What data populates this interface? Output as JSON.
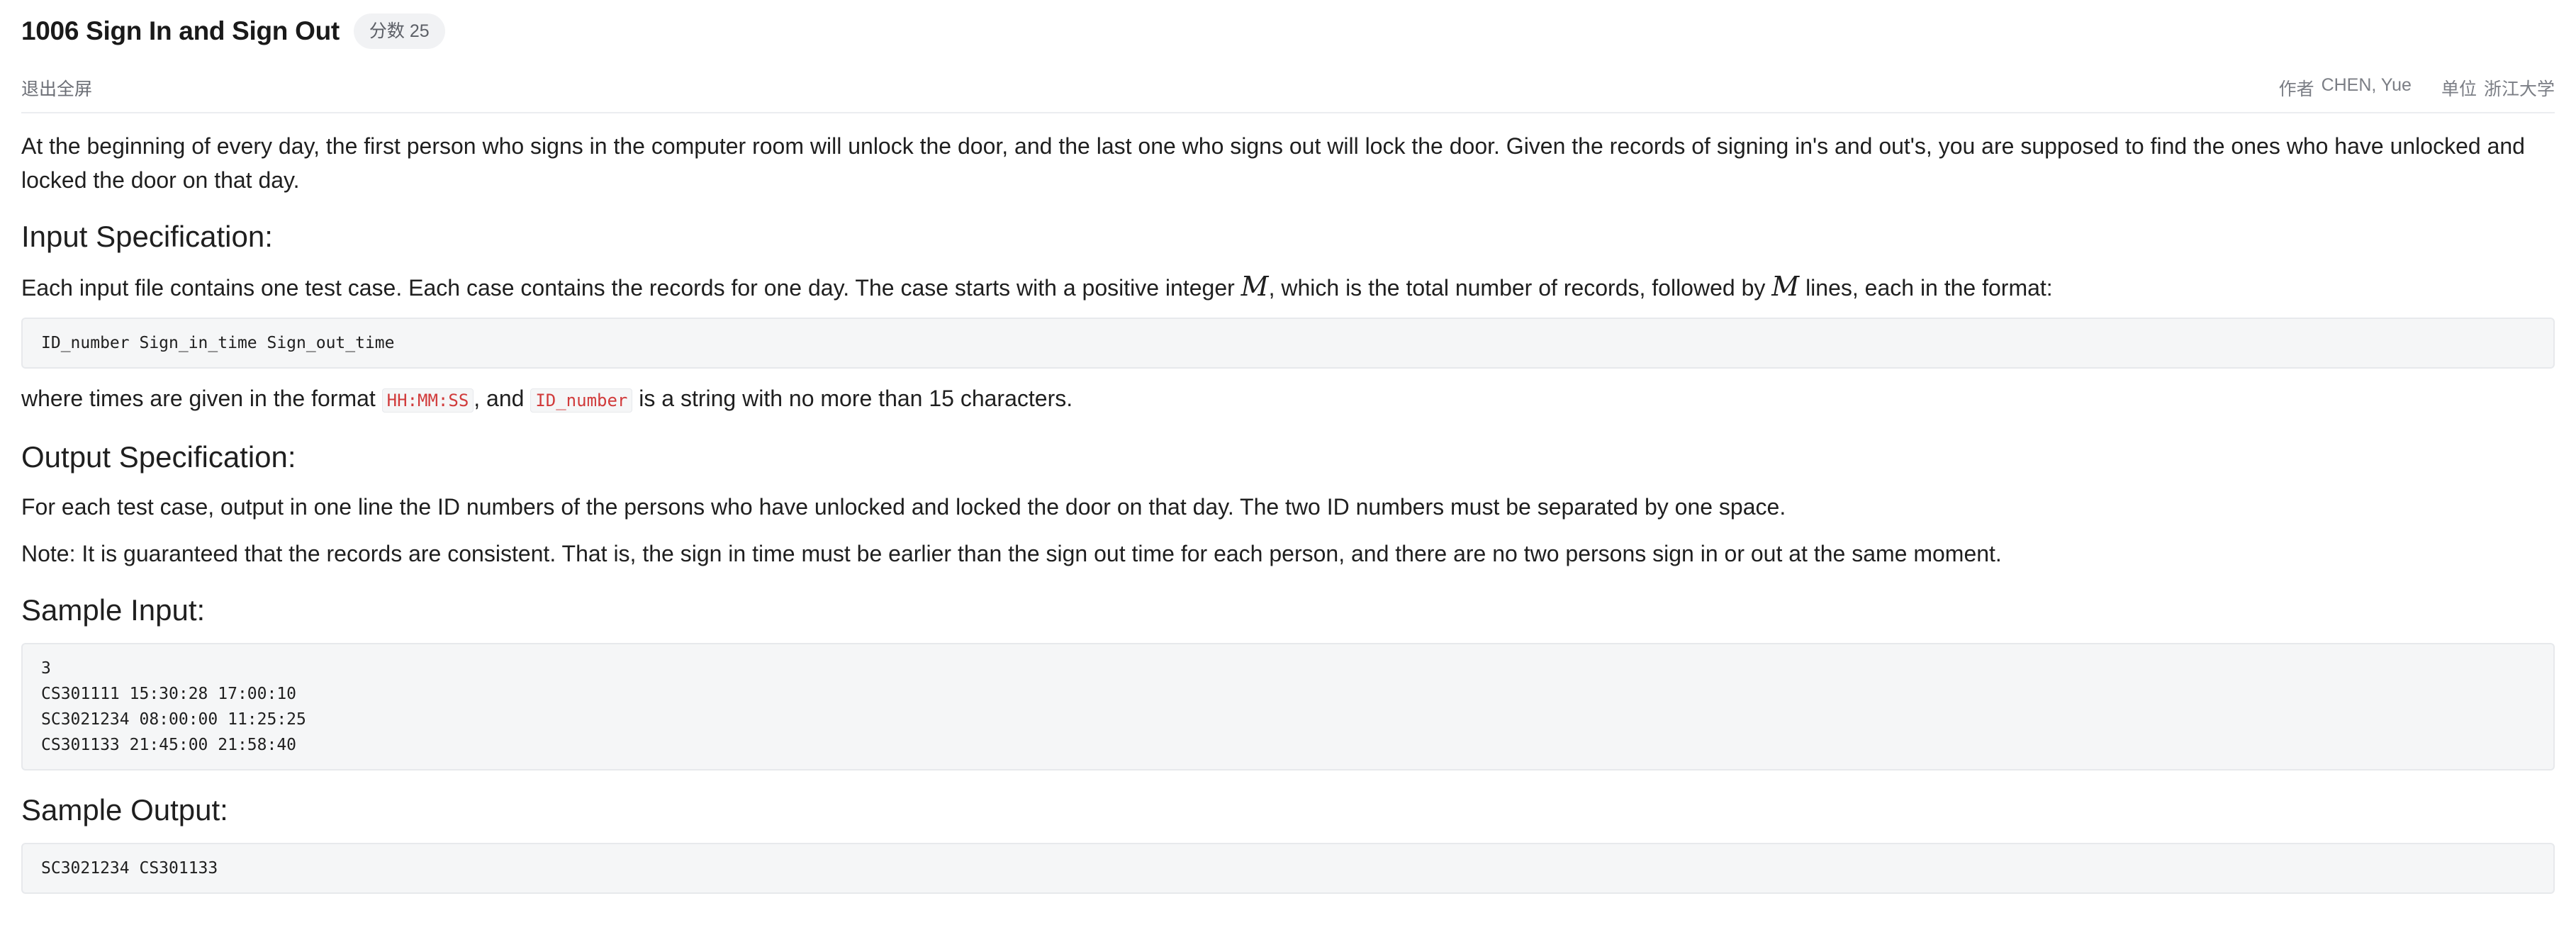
{
  "header": {
    "title": "1006 Sign In and Sign Out",
    "score_badge": "分数 25"
  },
  "meta": {
    "exit_fullscreen": "退出全屏",
    "author_label": "作者",
    "author_value": "CHEN, Yue",
    "unit_label": "单位",
    "unit_value": "浙江大学"
  },
  "problem": {
    "intro": "At the beginning of every day, the first person who signs in the computer room will unlock the door, and the last one who signs out will lock the door.  Given the records of signing in's and out's, you are supposed to find the ones who have un­locked and locked the door on that day.",
    "input_heading": "Input Specification:",
    "input_text_1": "Each input file contains one test case. Each case contains the records for one day.  The case starts with a positive integer ",
    "math_m": "M",
    "input_text_2": ", which is the total number of records, followed by ",
    "input_text_3": " lines, each in the format:",
    "format_code": "ID_number Sign_in_time Sign_out_time",
    "where_text_1": "where times are given in the format ",
    "time_format_code": "HH:MM:SS",
    "where_text_2": ", and ",
    "id_code": "ID_number",
    "where_text_3": " is a string with no more than 15 characters.",
    "output_heading": "Output Specification:",
    "output_text": "For each test case, output in one line the ID numbers of the persons who have unlocked and locked the door on that day.  The two ID numbers must be separated by one space.",
    "note_text": "Note:  It is guaranteed that the records are consistent.  That is, the sign in time must be earlier than the sign out time for each person, and there are no two persons sign in or out at the same moment.",
    "sample_input_heading": "Sample Input:",
    "sample_input": "3\nCS301111 15:30:28 17:00:10\nSC3021234 08:00:00 11:25:25\nCS301133 21:45:00 21:58:40",
    "sample_output_heading": "Sample Output:",
    "sample_output": "SC3021234 CS301133"
  }
}
